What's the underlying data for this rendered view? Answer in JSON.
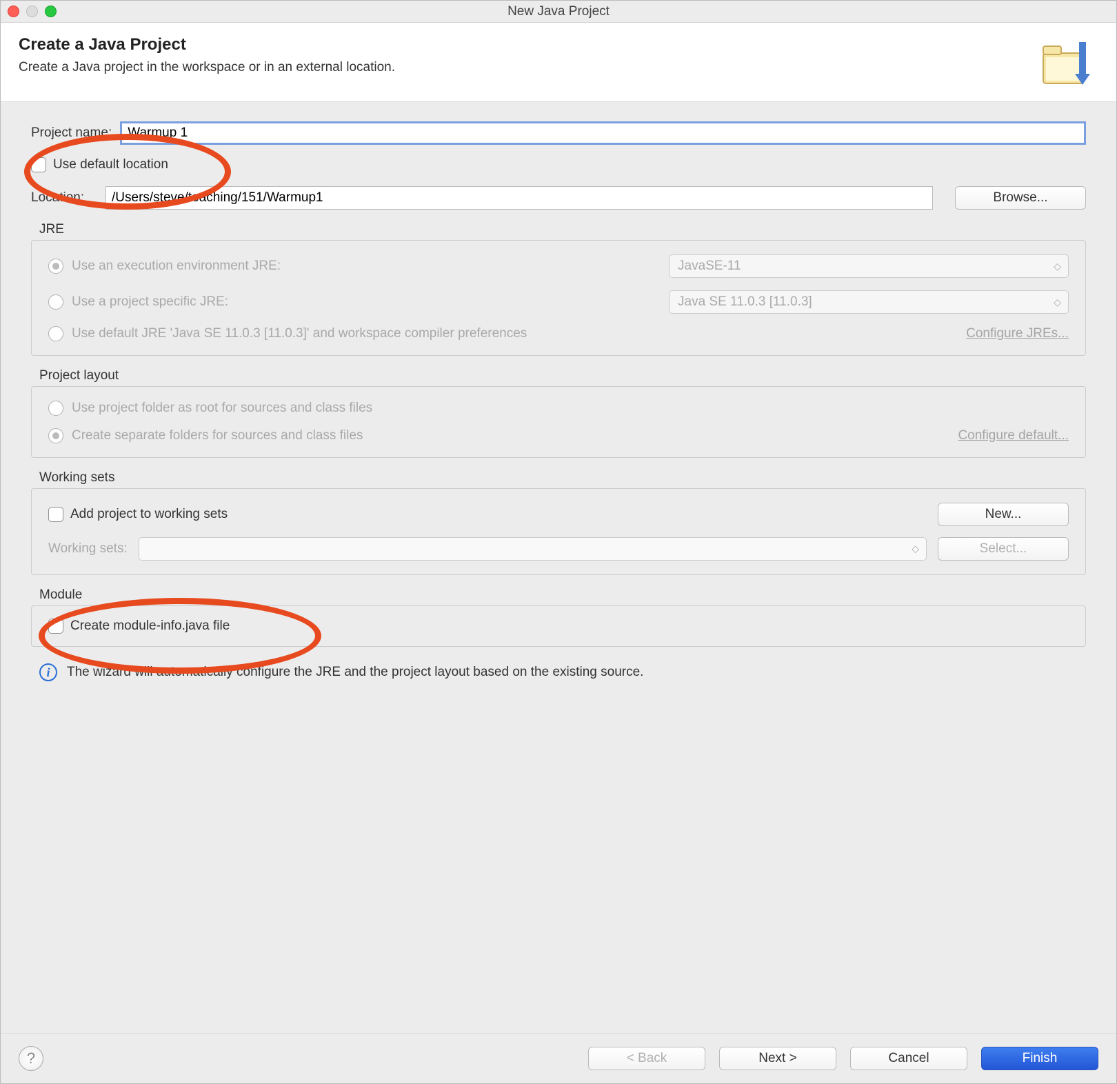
{
  "window": {
    "title": "New Java Project"
  },
  "header": {
    "title": "Create a Java Project",
    "subtitle": "Create a Java project in the workspace or in an external location."
  },
  "project": {
    "name_label": "Project name:",
    "name_value": "Warmup 1",
    "use_default_label": "Use default location",
    "location_label": "Location:",
    "location_value": "/Users/steve/teaching/151/Warmup1",
    "browse_label": "Browse..."
  },
  "jre": {
    "section_title": "JRE",
    "opt_exec_env": "Use an execution environment JRE:",
    "exec_env_value": "JavaSE-11",
    "opt_project_specific": "Use a project specific JRE:",
    "project_specific_value": "Java SE 11.0.3 [11.0.3]",
    "opt_default": "Use default JRE 'Java SE 11.0.3 [11.0.3]' and workspace compiler preferences",
    "configure_link": "Configure JREs..."
  },
  "layout": {
    "section_title": "Project layout",
    "opt_root": "Use project folder as root for sources and class files",
    "opt_separate": "Create separate folders for sources and class files",
    "configure_link": "Configure default..."
  },
  "working_sets": {
    "section_title": "Working sets",
    "add_label": "Add project to working sets",
    "new_label": "New...",
    "ws_label": "Working sets:",
    "select_label": "Select..."
  },
  "module": {
    "section_title": "Module",
    "create_label": "Create module-info.java file"
  },
  "info": {
    "text": "The wizard will automatically configure the JRE and the project layout based on the existing source."
  },
  "footer": {
    "back": "< Back",
    "next": "Next >",
    "cancel": "Cancel",
    "finish": "Finish"
  }
}
